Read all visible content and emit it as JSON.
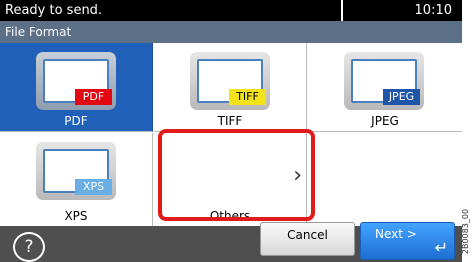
{
  "status": {
    "message": "Ready to send.",
    "time": "10:10"
  },
  "screen_title": "File Format",
  "formats": [
    {
      "label": "PDF",
      "tag": "PDF",
      "selected": true
    },
    {
      "label": "TIFF",
      "tag": "TIFF",
      "selected": false
    },
    {
      "label": "JPEG",
      "tag": "JPEG",
      "selected": false
    },
    {
      "label": "XPS",
      "tag": "XPS",
      "selected": false
    },
    {
      "label": "Others",
      "chevron": "›",
      "selected": false
    }
  ],
  "footer": {
    "help_glyph": "?",
    "cancel_label": "Cancel",
    "next_label": "Next >",
    "next_enter_glyph": "↵"
  },
  "side_code": "2B0083_00",
  "icons": {
    "help": "help-icon",
    "enter": "enter-icon",
    "chevron": "chevron-right-icon"
  },
  "colors": {
    "selected": "#2060b8",
    "highlight": "#e21a1a",
    "title_bar": "#5b6f86",
    "next_button": "#2b88e6"
  }
}
